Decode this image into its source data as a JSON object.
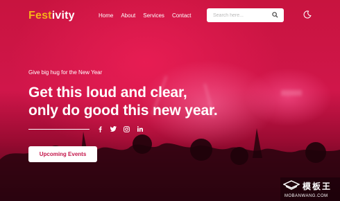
{
  "brand": {
    "logo_part1": "Fest",
    "logo_part2": "ivity",
    "logo_part1_color": "#f6b21a",
    "logo_part2_color": "#ffffff"
  },
  "nav": {
    "items": [
      {
        "label": "Home"
      },
      {
        "label": "About"
      },
      {
        "label": "Services"
      },
      {
        "label": "Contact"
      }
    ]
  },
  "search": {
    "placeholder": "Search here...",
    "value": "",
    "icon": "search-icon"
  },
  "theme_toggle": {
    "icon": "moon-icon"
  },
  "hero": {
    "tagline": "Give big hug for the New Year",
    "headline_line1": "Get this loud and clear,",
    "headline_line2": "only do good this new year.",
    "social_icons": [
      "facebook-icon",
      "twitter-icon",
      "instagram-icon",
      "linkedin-icon"
    ],
    "cta_label": "Upcoming Events",
    "accent_color": "#c4164a"
  },
  "watermark": {
    "site_name_cn": "模板王",
    "site_url": "MOBANWANG.COM"
  }
}
